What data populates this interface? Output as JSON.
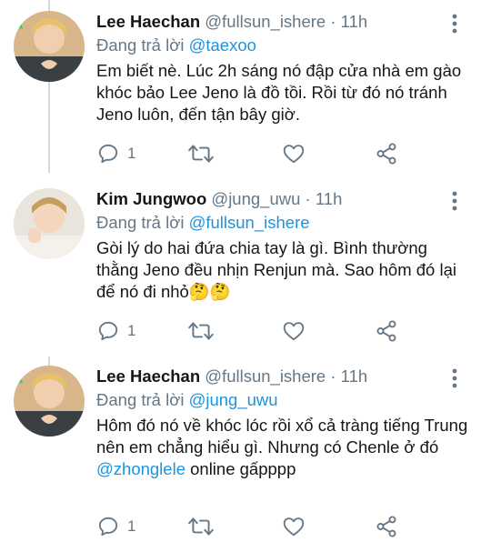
{
  "tweets": [
    {
      "name": "Lee Haechan",
      "handle": "@fullsun_ishere",
      "sep": "·",
      "time": "11h",
      "reply_prefix": "Đang trả lời",
      "reply_to": "@taexoo",
      "text": "Em biết nè. Lúc 2h sáng nó đập cửa nhà em gào khóc bảo Lee Jeno là đồ tồi. Rồi từ đó nó tránh Jeno luôn, đến tận bây giờ.",
      "reply_count": "1"
    },
    {
      "name": "Kim Jungwoo",
      "handle": "@jung_uwu",
      "sep": "·",
      "time": "11h",
      "reply_prefix": "Đang trả lời",
      "reply_to": "@fullsun_ishere",
      "text": "Gòi lý do hai đứa chia tay là gì. Bình thường thằng Jeno đều nhịn Renjun mà. Sao hôm đó lại để nó đi nhỏ",
      "emoji": "🤔🤔",
      "reply_count": "1"
    },
    {
      "name": "Lee Haechan",
      "handle": "@fullsun_ishere",
      "sep": "·",
      "time": "11h",
      "reply_prefix": "Đang trả lời",
      "reply_to": "@jung_uwu",
      "text": "Hôm đó nó về khóc lóc rồi xổ cả tràng tiếng Trung nên em chẳng hiểu gì. Nhưng có Chenle ở đó",
      "mention": "@zhonglele",
      "text_after": " online gấpppp",
      "reply_count": "1"
    }
  ],
  "colors": {
    "text": "#14171a",
    "secondary": "#657786",
    "link": "#1b95e0",
    "thread_line": "#cfd9de"
  },
  "icons": [
    "reply-icon",
    "retweet-icon",
    "like-icon",
    "share-icon",
    "more-vertical-icon"
  ]
}
